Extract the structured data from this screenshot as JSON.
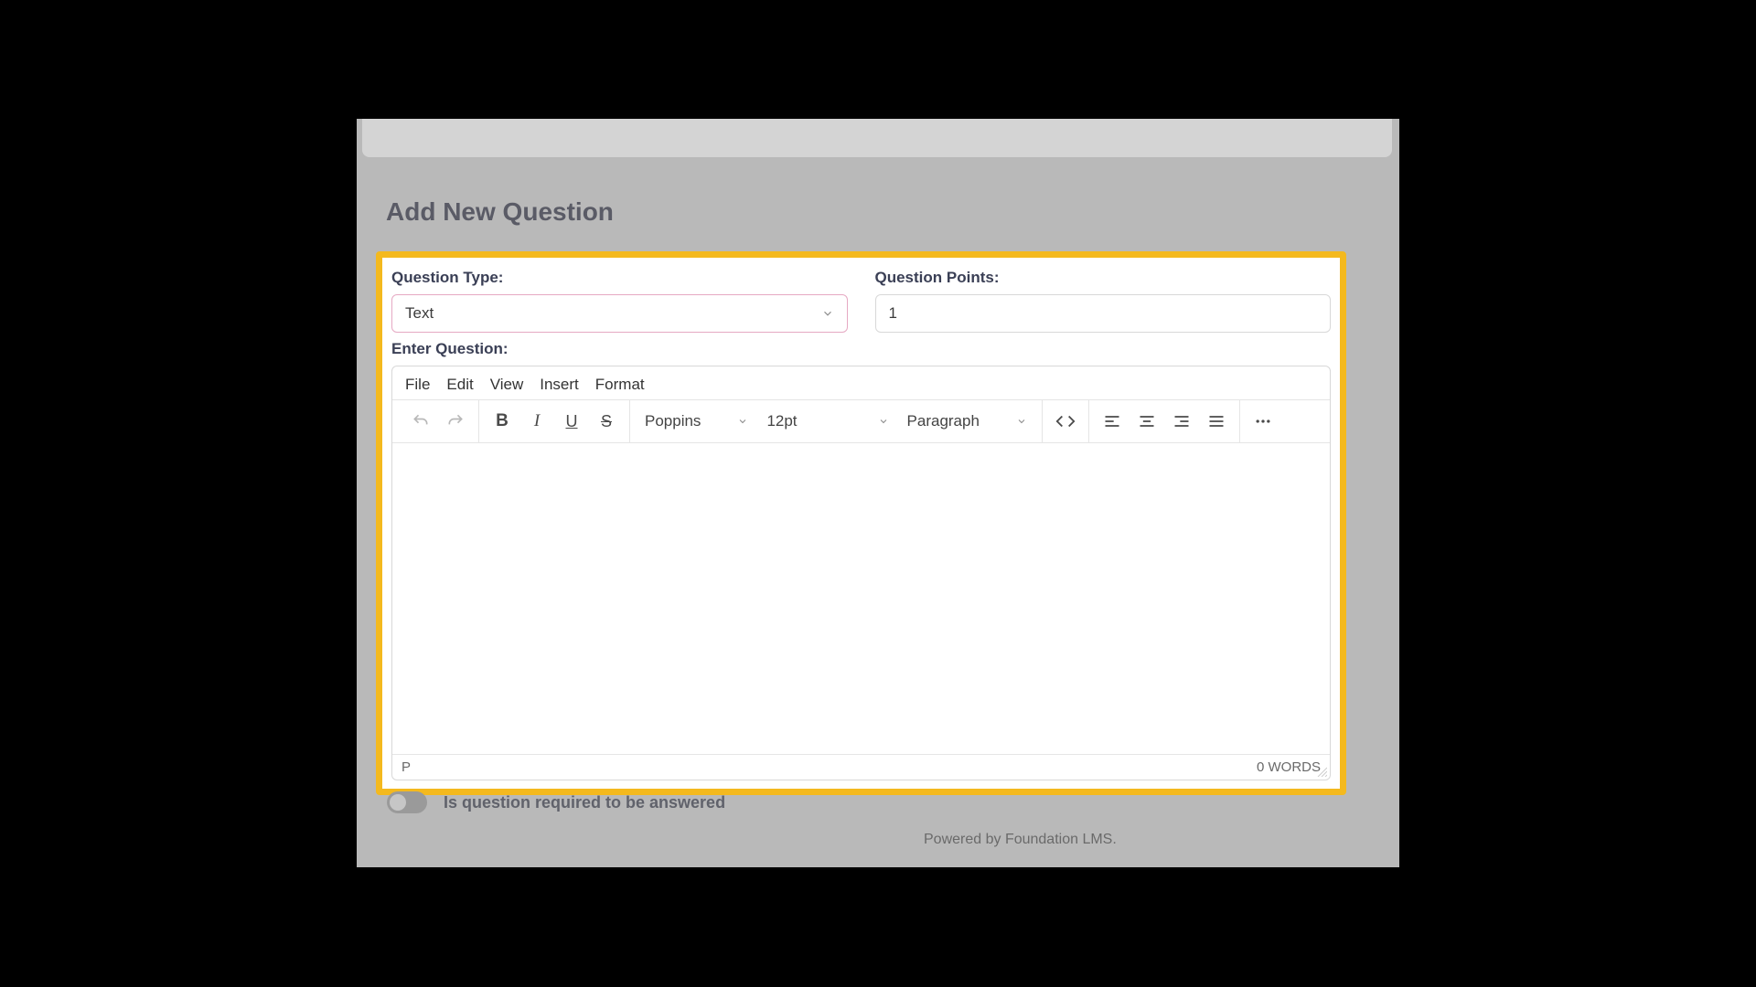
{
  "page": {
    "title": "Add New Question",
    "required_label": "Is question required to be answered",
    "powered_by": "Powered by Foundation LMS."
  },
  "form": {
    "type_label": "Question Type:",
    "type_value": "Text",
    "points_label": "Question Points:",
    "points_value": "1",
    "enter_label": "Enter Question:"
  },
  "editor": {
    "menubar": {
      "file": "File",
      "edit": "Edit",
      "view": "View",
      "insert": "Insert",
      "format": "Format"
    },
    "toolbar": {
      "font_family": "Poppins",
      "font_size": "12pt",
      "block_format": "Paragraph"
    },
    "status": {
      "path": "P",
      "words": "0 WORDS"
    }
  },
  "icons": {
    "undo": "undo-icon",
    "redo": "redo-icon",
    "bold": "bold-icon",
    "italic": "italic-icon",
    "underline": "underline-icon",
    "strike": "strike-icon",
    "code": "code-icon",
    "align_left": "align-left-icon",
    "align_center": "align-center-icon",
    "align_right": "align-right-icon",
    "align_justify": "align-justify-icon",
    "more": "more-icon",
    "chevron": "chevron-down-icon"
  },
  "colors": {
    "highlight_border": "#f4b91e",
    "select_border": "#e6a9c3"
  }
}
